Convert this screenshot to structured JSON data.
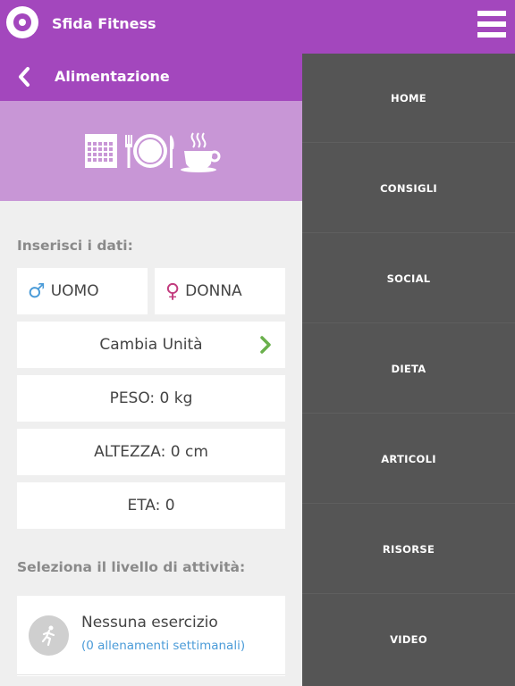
{
  "app": {
    "title": "Sfida Fitness"
  },
  "header": {
    "section_title": "Alimentazione"
  },
  "form": {
    "input_label": "Inserisci i dati:",
    "male_label": "UOMO",
    "female_label": "DONNA",
    "male_symbol": "♂",
    "female_symbol": "♀",
    "change_units_label": "Cambia Unità",
    "weight_label": "PESO: 0 kg",
    "height_label": "ALTEZZA: 0 cm",
    "age_label": "ETA: 0",
    "activity_label": "Seleziona il livello di attività:"
  },
  "activity": {
    "title": "Nessuna esercizio",
    "subtitle": "(0 allenamenti settimanali)"
  },
  "menu": {
    "items": [
      "HOME",
      "CONSIGLI",
      "SOCIAL",
      "DIETA",
      "ARTICOLI",
      "RISORSE",
      "VIDEO"
    ]
  },
  "colors": {
    "primary": "#a347bd",
    "banner": "#c896d6",
    "menu_bg": "#555555",
    "male_icon": "#4a9bd8",
    "female_icon": "#c23b7e",
    "chevron": "#6ab04c",
    "link": "#4a9bd8"
  },
  "icons": [
    "app-logo-icon",
    "hamburger-menu-icon",
    "back-arrow-icon",
    "calendar-icon",
    "fork-icon",
    "plate-icon",
    "knife-icon",
    "coffee-cup-icon",
    "male-icon",
    "female-icon",
    "chevron-right-icon",
    "running-person-icon"
  ]
}
